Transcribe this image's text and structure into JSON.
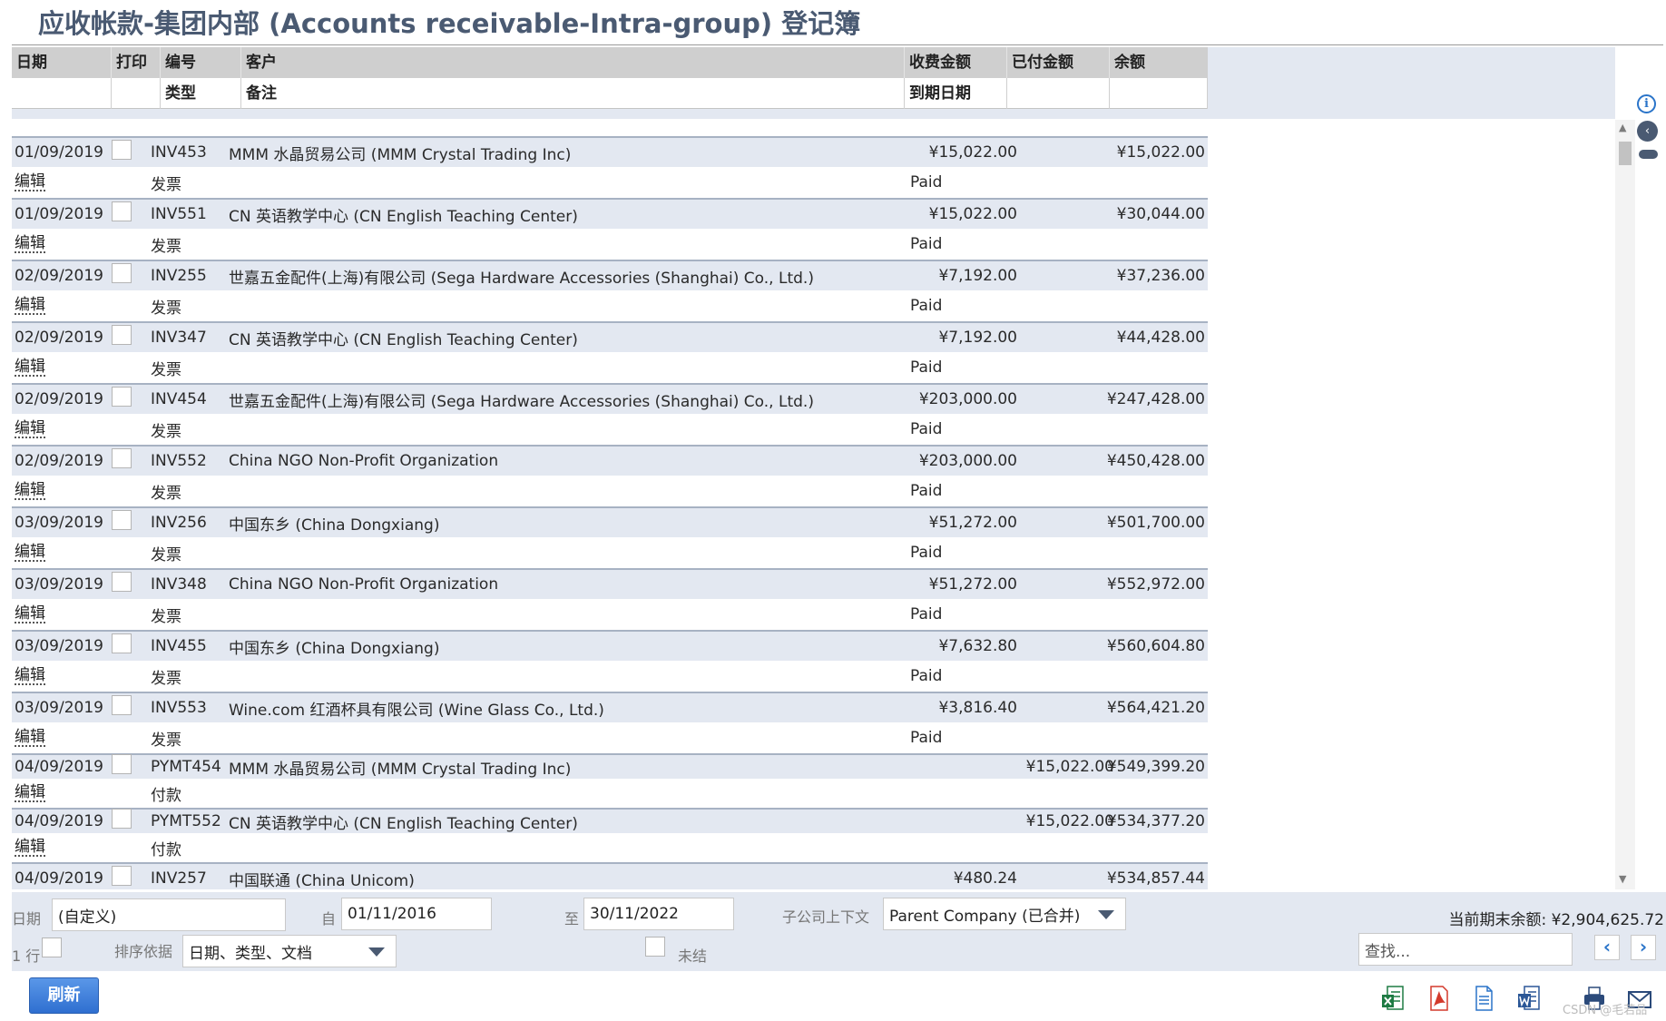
{
  "title": "应收帐款-集团内部 (Accounts receivable-Intra-group) 登记簿",
  "columns": {
    "date": "日期",
    "print": "打印",
    "number": "编号",
    "customer": "客户",
    "charge": "收费金额",
    "paid": "已付金额",
    "balance": "余额",
    "type": "类型",
    "memo": "备注",
    "due_date": "到期日期"
  },
  "edit_label": "编辑",
  "entries": [
    {
      "date": "01/09/2019",
      "number": "INV453",
      "customer": "MMM 水晶贸易公司 (MMM Crystal Trading Inc)",
      "charge": "¥15,022.00",
      "paid": "",
      "balance": "¥15,022.00",
      "type": "发票",
      "due": "Paid",
      "kind": "inv"
    },
    {
      "date": "01/09/2019",
      "number": "INV551",
      "customer": "CN 英语教学中心 (CN English Teaching Center)",
      "charge": "¥15,022.00",
      "paid": "",
      "balance": "¥30,044.00",
      "type": "发票",
      "due": "Paid",
      "kind": "inv"
    },
    {
      "date": "02/09/2019",
      "number": "INV255",
      "customer": "世嘉五金配件(上海)有限公司 (Sega Hardware Accessories (Shanghai) Co., Ltd.)",
      "charge": "¥7,192.00",
      "paid": "",
      "balance": "¥37,236.00",
      "type": "发票",
      "due": "Paid",
      "kind": "inv"
    },
    {
      "date": "02/09/2019",
      "number": "INV347",
      "customer": "CN 英语教学中心 (CN English Teaching Center)",
      "charge": "¥7,192.00",
      "paid": "",
      "balance": "¥44,428.00",
      "type": "发票",
      "due": "Paid",
      "kind": "inv"
    },
    {
      "date": "02/09/2019",
      "number": "INV454",
      "customer": "世嘉五金配件(上海)有限公司 (Sega Hardware Accessories (Shanghai) Co., Ltd.)",
      "charge": "¥203,000.00",
      "paid": "",
      "balance": "¥247,428.00",
      "type": "发票",
      "due": "Paid",
      "kind": "inv"
    },
    {
      "date": "02/09/2019",
      "number": "INV552",
      "customer": "China NGO Non-Profit Organization",
      "charge": "¥203,000.00",
      "paid": "",
      "balance": "¥450,428.00",
      "type": "发票",
      "due": "Paid",
      "kind": "inv"
    },
    {
      "date": "03/09/2019",
      "number": "INV256",
      "customer": "中国东乡 (China Dongxiang)",
      "charge": "¥51,272.00",
      "paid": "",
      "balance": "¥501,700.00",
      "type": "发票",
      "due": "Paid",
      "kind": "inv"
    },
    {
      "date": "03/09/2019",
      "number": "INV348",
      "customer": "China NGO Non-Profit Organization",
      "charge": "¥51,272.00",
      "paid": "",
      "balance": "¥552,972.00",
      "type": "发票",
      "due": "Paid",
      "kind": "inv"
    },
    {
      "date": "03/09/2019",
      "number": "INV455",
      "customer": "中国东乡 (China Dongxiang)",
      "charge": "¥7,632.80",
      "paid": "",
      "balance": "¥560,604.80",
      "type": "发票",
      "due": "Paid",
      "kind": "inv"
    },
    {
      "date": "03/09/2019",
      "number": "INV553",
      "customer": "Wine.com 红酒杯具有限公司 (Wine Glass Co., Ltd.)",
      "charge": "¥3,816.40",
      "paid": "",
      "balance": "¥564,421.20",
      "type": "发票",
      "due": "Paid",
      "kind": "inv"
    },
    {
      "date": "04/09/2019",
      "number": "PYMT454",
      "customer": "MMM 水晶贸易公司 (MMM Crystal Trading Inc)",
      "charge": "",
      "paid": "¥15,022.00",
      "balance": "¥549,399.20",
      "type": "付款",
      "due": "",
      "kind": "pay"
    },
    {
      "date": "04/09/2019",
      "number": "PYMT552",
      "customer": "CN 英语教学中心 (CN English Teaching Center)",
      "charge": "",
      "paid": "¥15,022.00",
      "balance": "¥534,377.20",
      "type": "付款",
      "due": "",
      "kind": "pay"
    },
    {
      "date": "04/09/2019",
      "number": "INV257",
      "customer": "中国联通 (China Unicom)",
      "charge": "¥480.24",
      "paid": "",
      "balance": "¥534,857.44",
      "type": "",
      "due": "",
      "kind": "inv"
    }
  ],
  "footer": {
    "date_label": "日期",
    "date_value": "(自定义)",
    "from_label": "自",
    "from_value": "01/11/2016",
    "to_label": "至",
    "to_value": "30/11/2022",
    "subsidiary_label": "子公司上下文",
    "subsidiary_value": "Parent Company (已合并)",
    "ending_balance": "当前期末余额:  ¥2,904,625.72",
    "rows_label": "1 行",
    "sort_label": "排序依据",
    "sort_value": "日期、类型、文档",
    "unclosed_label": "未结",
    "search_placeholder": "查找...",
    "prev": "‹",
    "next": "›"
  },
  "refresh_label": "刷新",
  "icons": {
    "info": "i",
    "collapse": "‹",
    "scroll_up": "▲",
    "scroll_down": "▼"
  },
  "watermark": "CSDN @毛若品",
  "colors": {
    "excel": "#1e7b43",
    "pdf": "#d33a2c",
    "doc": "#2a74c9",
    "word": "#2b5797",
    "printer": "#2b4a7a",
    "accent": "#4a5a72"
  }
}
